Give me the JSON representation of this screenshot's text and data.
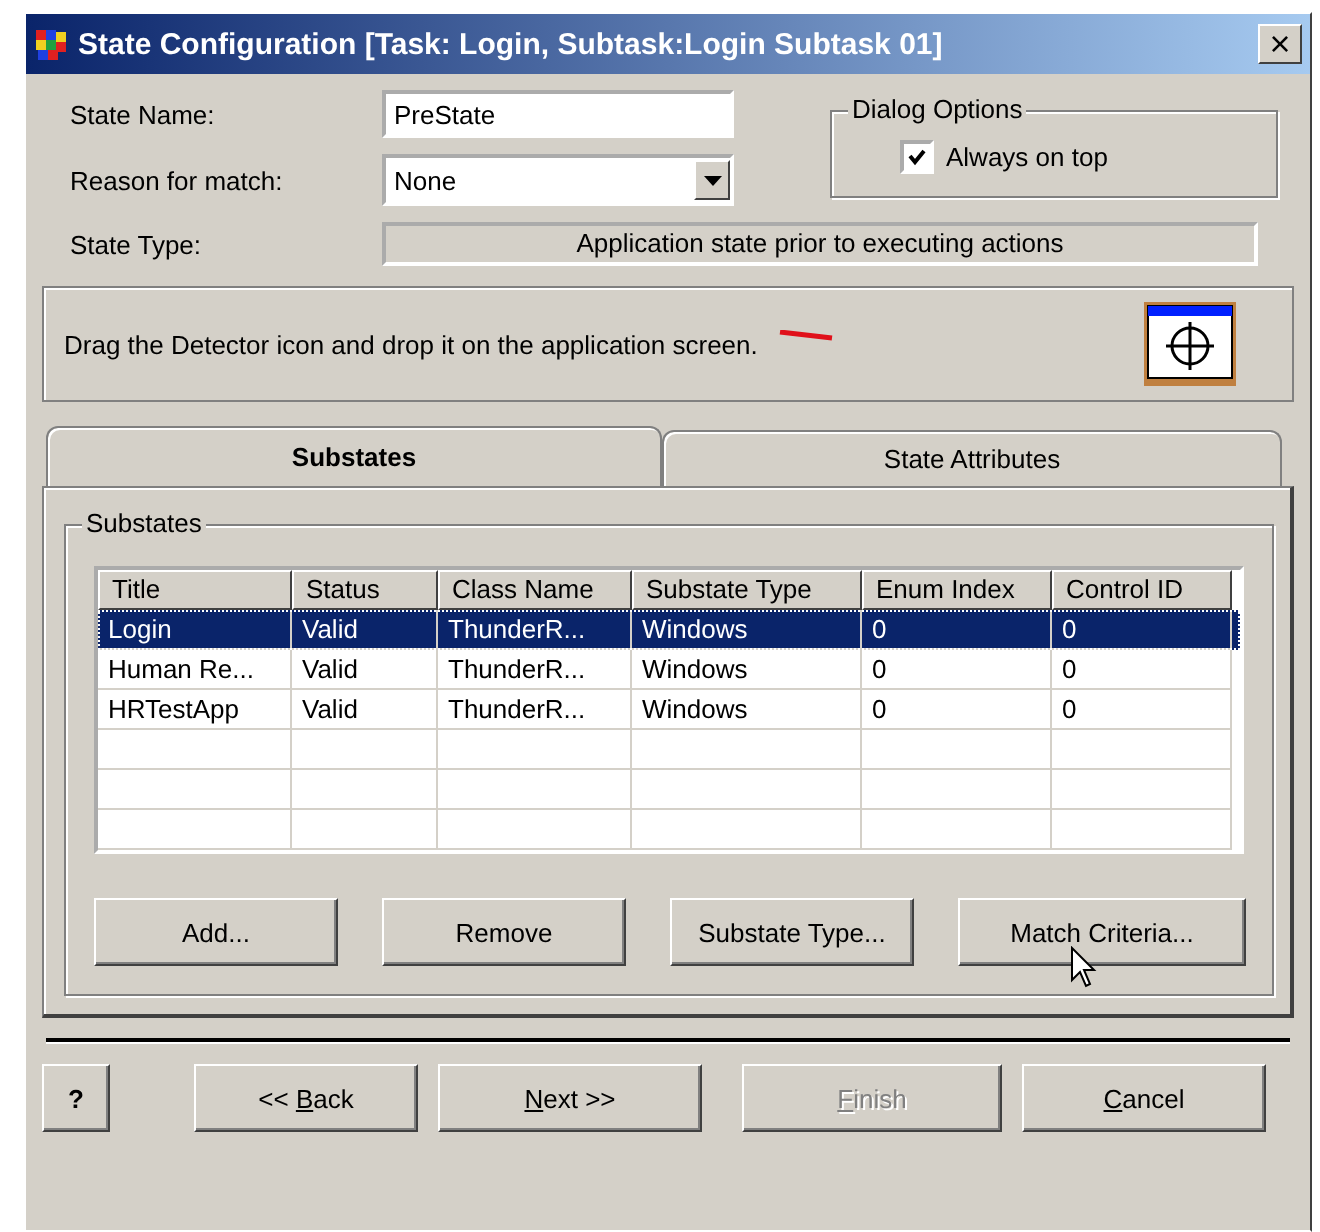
{
  "window": {
    "title": "State Configuration [Task: Login, Subtask:Login Subtask 01]",
    "close": "×"
  },
  "form": {
    "state_name_label": "State Name:",
    "state_name": "PreState",
    "reason_label": "Reason for match:",
    "reason": "None",
    "state_type_label": "State Type:",
    "state_type": "Application state prior to executing actions"
  },
  "dialog_options": {
    "title": "Dialog Options",
    "always_on_top": {
      "label": "Always on top",
      "checked": true
    }
  },
  "detector": {
    "instruction": "Drag the Detector icon and drop it on the application screen."
  },
  "tabs": [
    {
      "label": "Substates",
      "selected": true
    },
    {
      "label": "State Attributes",
      "selected": false
    }
  ],
  "substates": {
    "title": "Substates",
    "table": {
      "columns": [
        "Title",
        "Status",
        "Class Name",
        "Substate Type",
        "Enum Index",
        "Control ID"
      ],
      "rows": [
        {
          "cells": [
            "Login",
            "Valid",
            "ThunderR...",
            "Windows",
            "0",
            "0"
          ],
          "selected": true
        },
        {
          "cells": [
            "Human Re...",
            "Valid",
            "ThunderR...",
            "Windows",
            "0",
            "0"
          ],
          "selected": false
        },
        {
          "cells": [
            "HRTestApp",
            "Valid",
            "ThunderR...",
            "Windows",
            "0",
            "0"
          ],
          "selected": false
        }
      ]
    },
    "buttons": [
      "Add...",
      "Remove",
      "Substate Type...",
      "Match Criteria..."
    ]
  },
  "footer": {
    "help": "?",
    "buttons": [
      {
        "pre": "<< ",
        "key": "B",
        "post": "ack",
        "disabled": false
      },
      {
        "key": "N",
        "post": "ext >>",
        "disabled": false
      },
      {
        "key": "F",
        "post": "inish",
        "disabled": true
      },
      {
        "key": "C",
        "post": "ancel",
        "disabled": false
      }
    ]
  }
}
